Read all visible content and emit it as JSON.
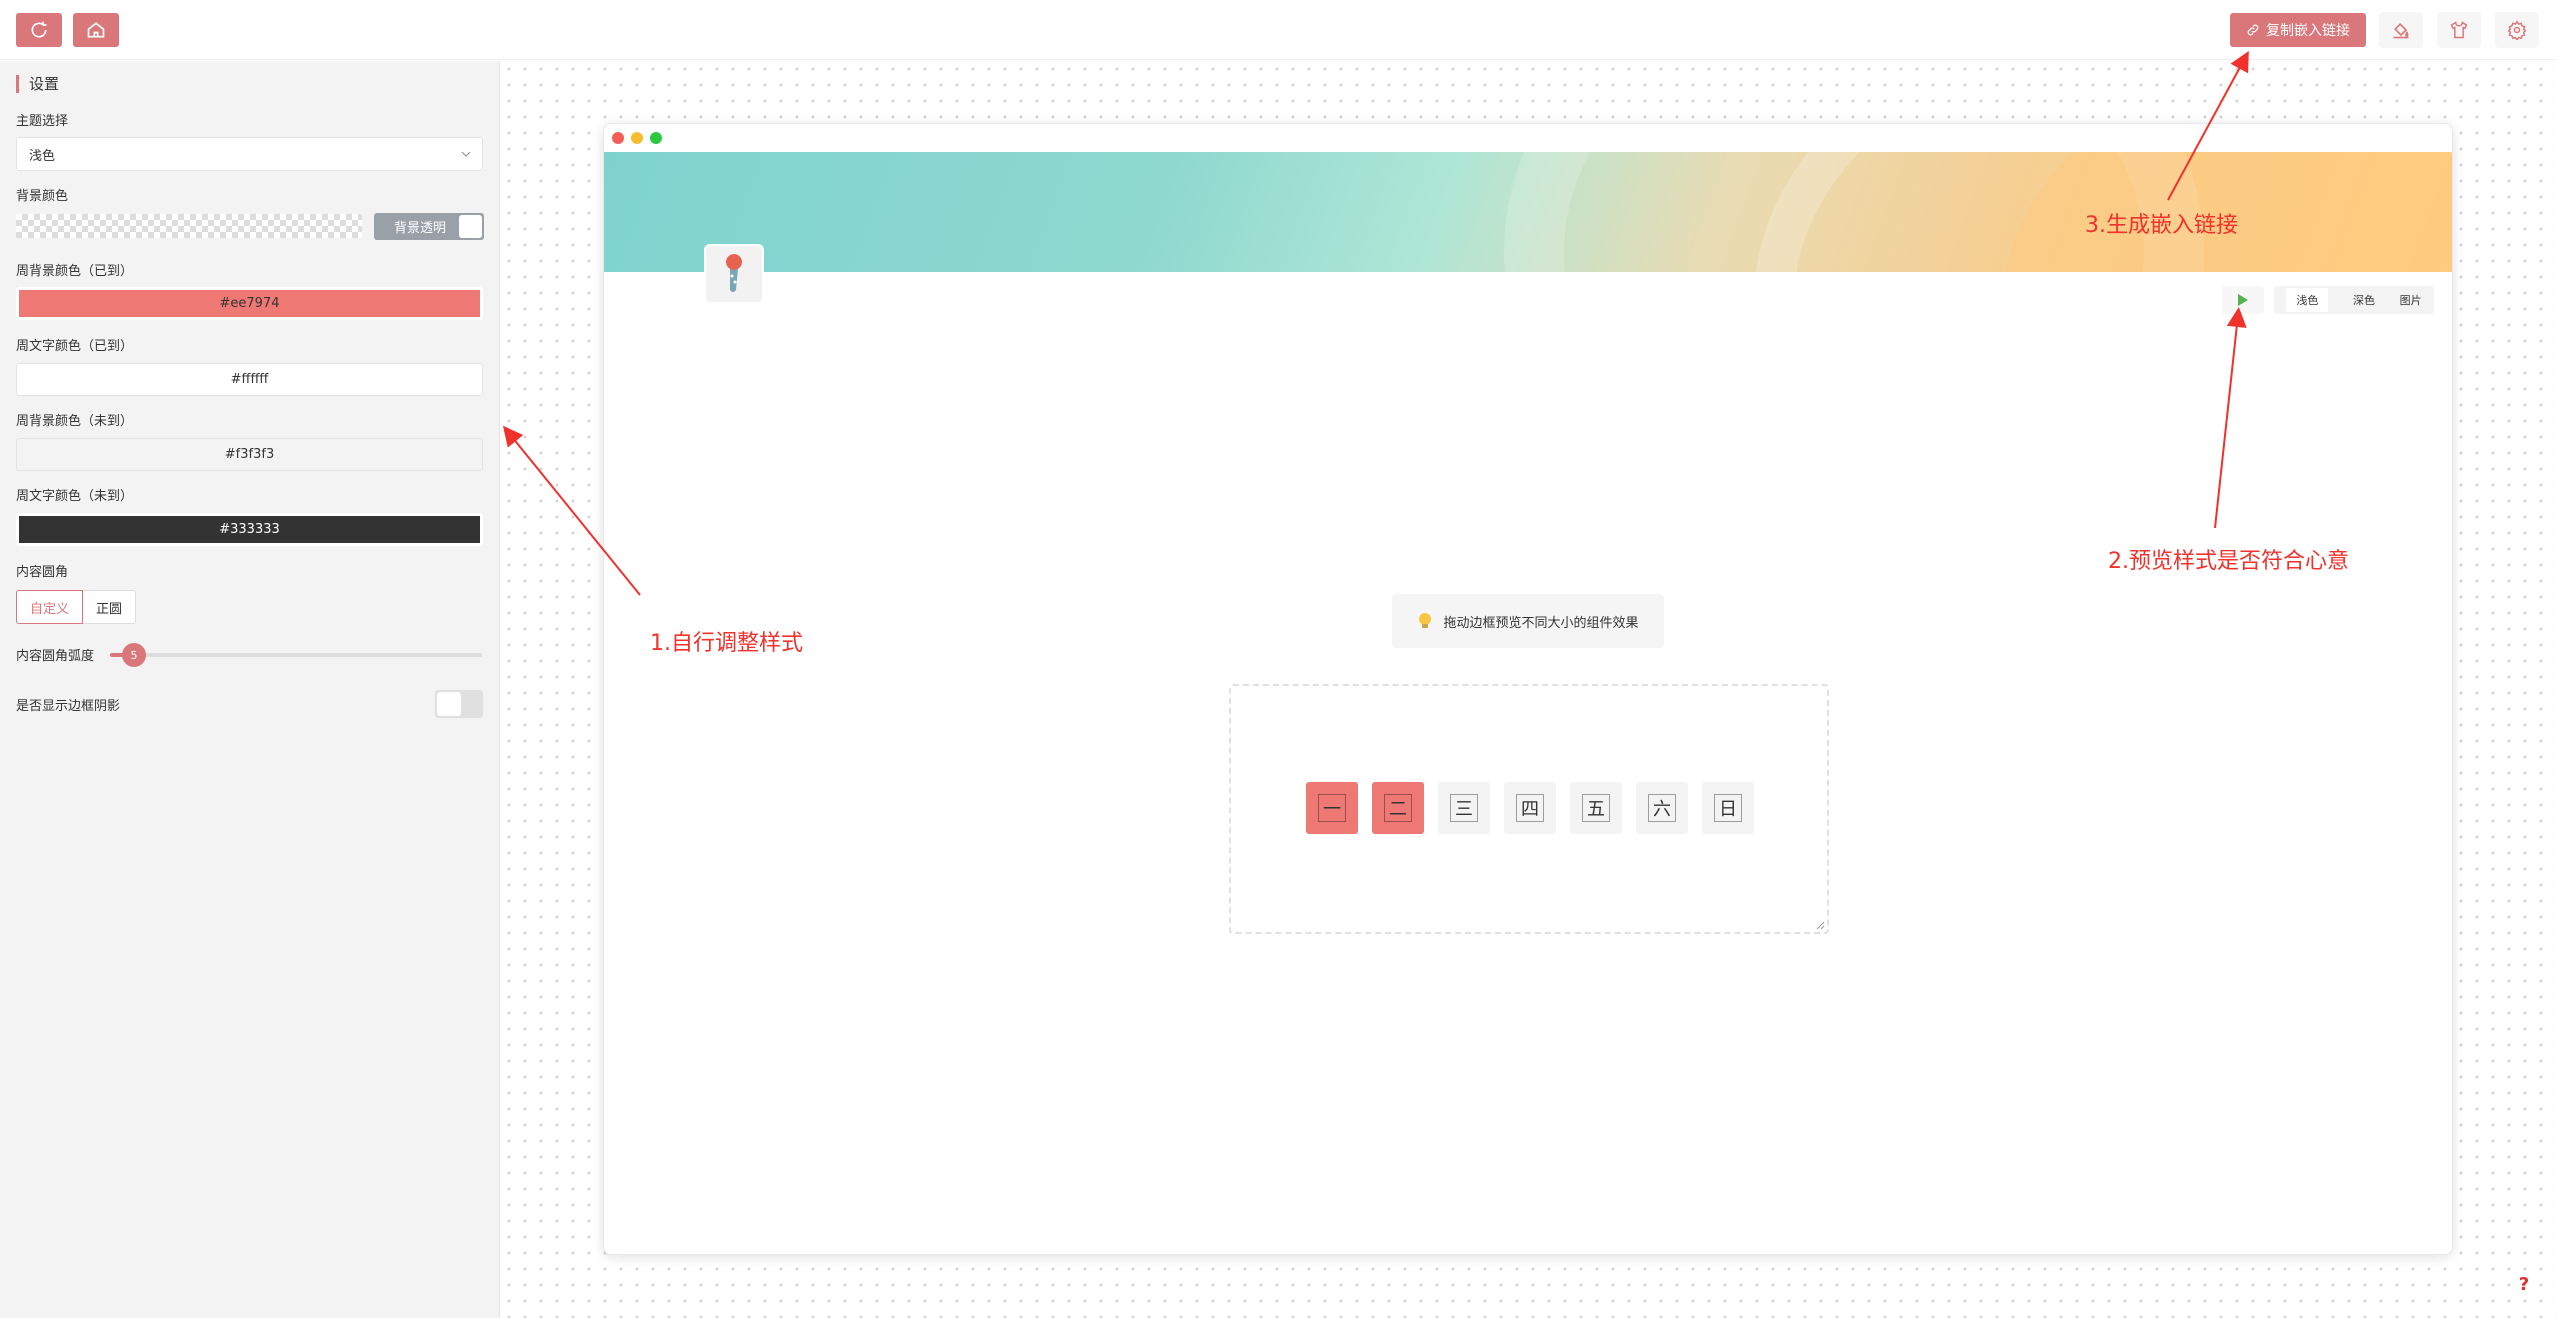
{
  "topbar": {
    "refresh": "refresh-icon",
    "home": "home-icon",
    "embed_label": "复制嵌入链接",
    "tools": [
      "paint-bucket-icon",
      "tshirt-icon",
      "gear-icon"
    ]
  },
  "sidebar": {
    "title": "设置",
    "theme_label": "主题选择",
    "theme_value": "浅色",
    "bg_label": "背景颜色",
    "bg_toggle": "背景透明",
    "done_bg_label": "周背景颜色（已到）",
    "done_bg_value": "#ee7974",
    "done_text_label": "周文字颜色（已到）",
    "done_text_value": "#ffffff",
    "todo_bg_label": "周背景颜色（未到）",
    "todo_bg_value": "#f3f3f3",
    "todo_text_label": "周文字颜色（未到）",
    "todo_text_value": "#333333",
    "radius_label": "内容圆角",
    "radius_options": [
      "自定义",
      "正圆"
    ],
    "radius_slider_label": "内容圆角弧度",
    "radius_slider_value": "5",
    "shadow_label": "是否显示边框阴影"
  },
  "preview": {
    "mode_tabs": [
      "浅色",
      "深色",
      "图片"
    ],
    "hint": "拖动边框预览不同大小的组件效果",
    "days": [
      {
        "label": "一",
        "state": "done"
      },
      {
        "label": "二",
        "state": "done"
      },
      {
        "label": "三",
        "state": "todo"
      },
      {
        "label": "四",
        "state": "todo"
      },
      {
        "label": "五",
        "state": "todo"
      },
      {
        "label": "六",
        "state": "todo"
      },
      {
        "label": "日",
        "state": "todo"
      }
    ]
  },
  "annotations": {
    "a1": "1.自行调整样式",
    "a2": "2.预览样式是否符合心意",
    "a3": "3.生成嵌入链接"
  },
  "help": "?",
  "colors": {
    "accent": "#d9777a",
    "done": "#ee7974",
    "todo": "#f3f3f3",
    "annotation": "#f0312c"
  }
}
